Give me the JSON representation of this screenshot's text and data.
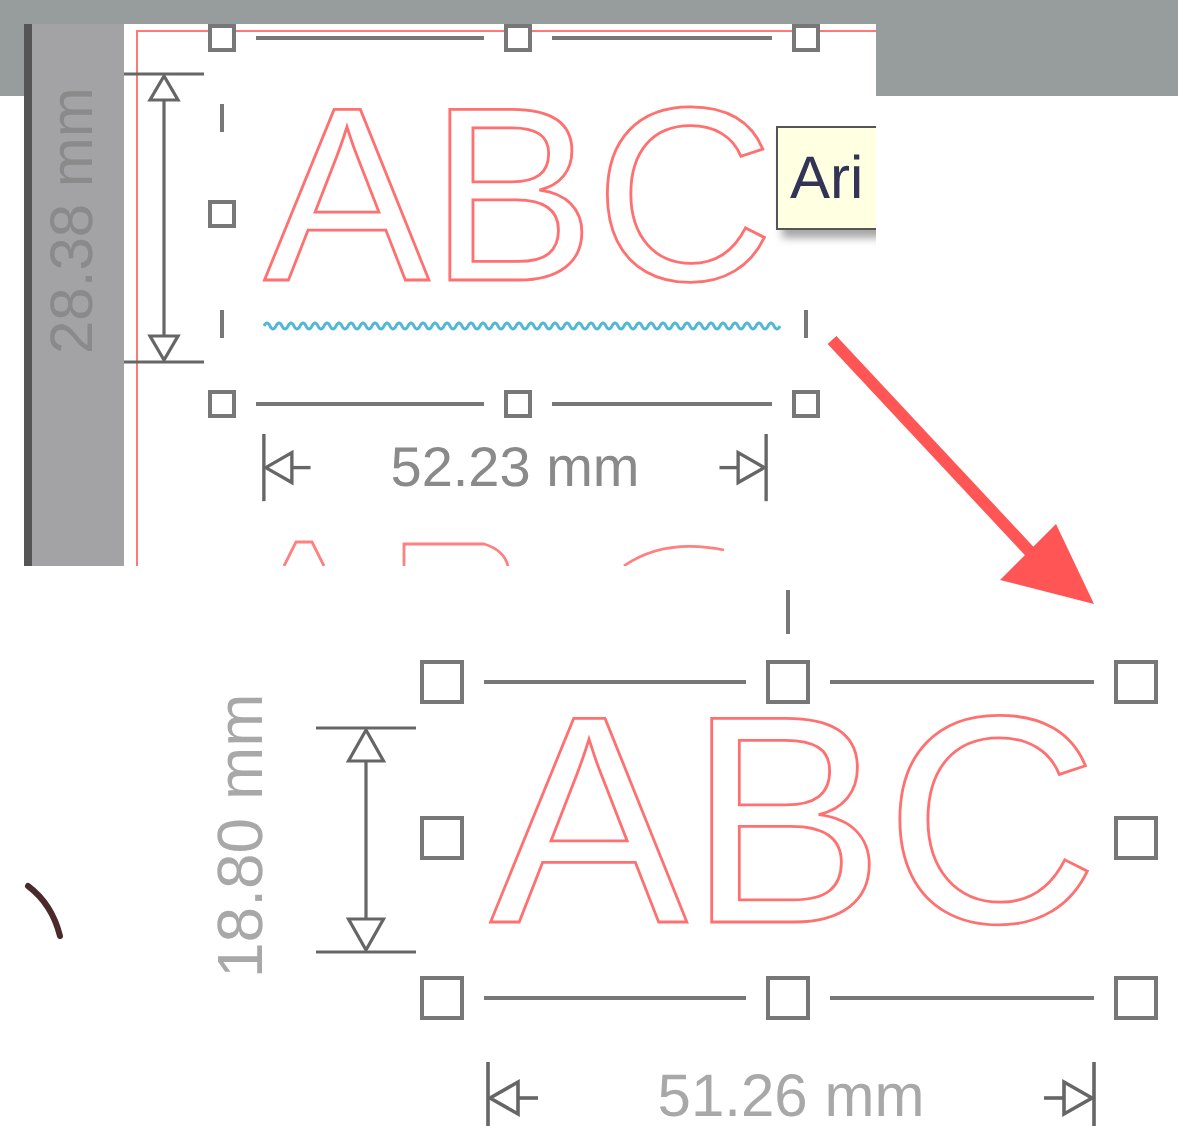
{
  "panels": [
    {
      "kind": "framed",
      "text": "ABC",
      "height_label": "28.38 mm",
      "width_label": "52.23 mm",
      "tooltip": "Ari",
      "spell_underline": true
    },
    {
      "kind": "plain",
      "text": "ABC",
      "height_label": "18.80 mm",
      "width_label": "51.26 mm"
    }
  ]
}
